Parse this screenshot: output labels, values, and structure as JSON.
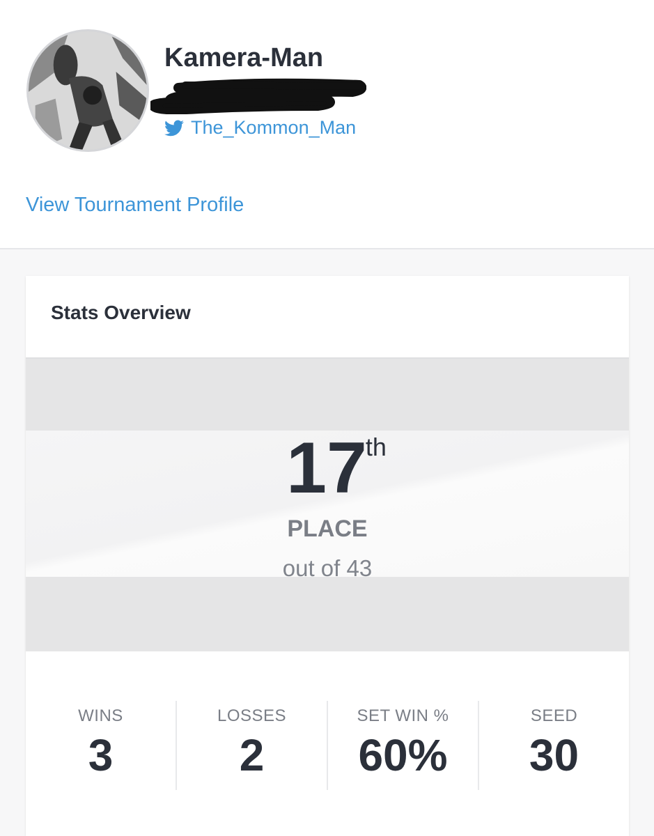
{
  "profile": {
    "name": "Kamera-Man",
    "twitter_handle": "The_Kommon_Man",
    "tournament_link": "View Tournament Profile",
    "twitter_color": "#3d95d8"
  },
  "stats_overview": {
    "title": "Stats Overview",
    "placement": {
      "rank": "17",
      "suffix": "th",
      "label": "PLACE",
      "out_of": "out of 43"
    },
    "stats": [
      {
        "label": "WINS",
        "value": "3"
      },
      {
        "label": "LOSSES",
        "value": "2"
      },
      {
        "label": "SET WIN %",
        "value": "60%"
      },
      {
        "label": "SEED",
        "value": "30"
      }
    ]
  }
}
